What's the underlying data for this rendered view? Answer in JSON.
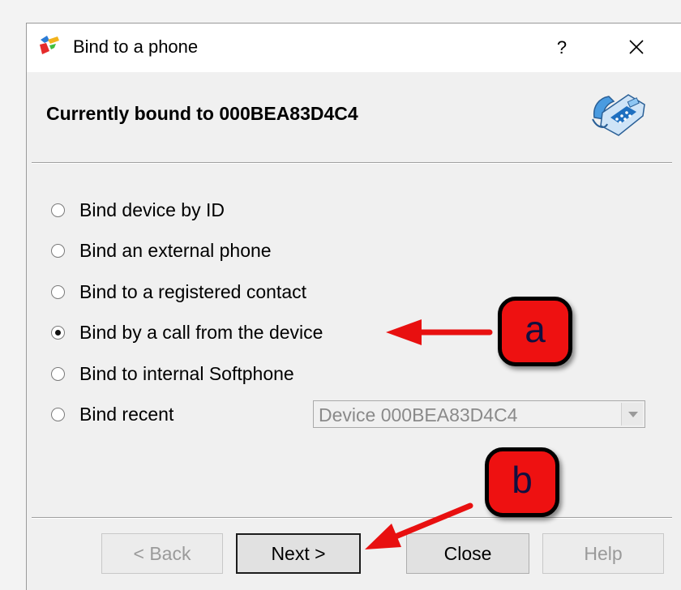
{
  "window": {
    "title": "Bind to a phone",
    "help_label": "?",
    "icons": {
      "app": "app-logo-icon",
      "close": "close-icon",
      "header": "desk-phone-icon"
    }
  },
  "header": {
    "title": "Currently bound to 000BEA83D4C4"
  },
  "options": [
    {
      "label": "Bind device by ID",
      "checked": false
    },
    {
      "label": "Bind an external phone",
      "checked": false
    },
    {
      "label": "Bind to a registered contact",
      "checked": false
    },
    {
      "label": "Bind by a call from the device",
      "checked": true
    },
    {
      "label": "Bind to internal Softphone",
      "checked": false
    },
    {
      "label": "Bind recent",
      "checked": false
    }
  ],
  "recent_select": {
    "value": "Device 000BEA83D4C4",
    "disabled": true
  },
  "buttons": {
    "back": "< Back",
    "next": "Next >",
    "close": "Close",
    "help": "Help"
  },
  "annotations": {
    "a": "a",
    "b": "b",
    "color": "#ee1111"
  }
}
